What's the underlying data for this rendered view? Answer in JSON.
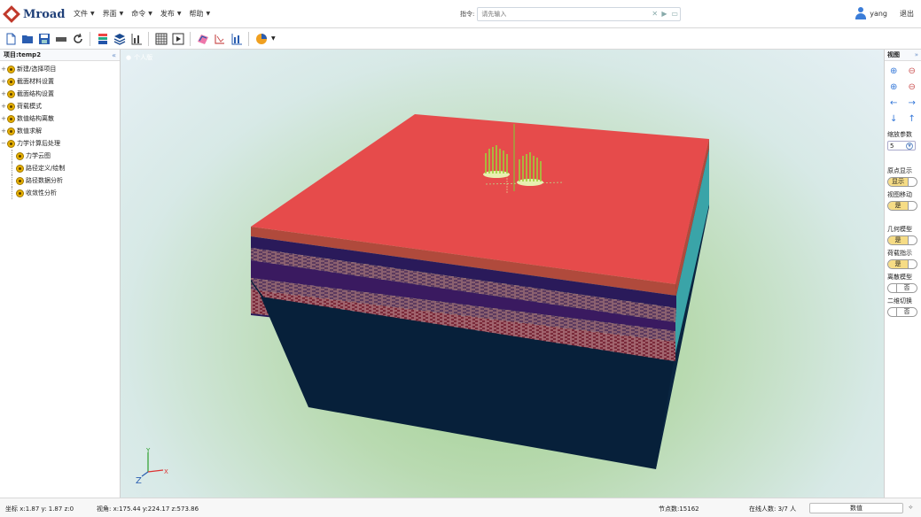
{
  "app": {
    "logo_text": "Mroad"
  },
  "menus": [
    {
      "label": "文件"
    },
    {
      "label": "界面"
    },
    {
      "label": "命令"
    },
    {
      "label": "发布"
    },
    {
      "label": "帮助"
    }
  ],
  "command": {
    "label": "指令:",
    "placeholder": "请先输入"
  },
  "user": {
    "name": "yang",
    "exit_label": "退出"
  },
  "left_panel": {
    "title": "项目:temp2",
    "collapse_glyph": "«",
    "items": [
      {
        "label": "新建/选择项目"
      },
      {
        "label": "截面材料设置"
      },
      {
        "label": "截面结构设置"
      },
      {
        "label": "荷载模式"
      },
      {
        "label": "数值结构离散"
      },
      {
        "label": "数值求解"
      },
      {
        "label": "力学计算后处理"
      }
    ],
    "children": [
      {
        "label": "力学云图"
      },
      {
        "label": "路径定义/绘制"
      },
      {
        "label": "路径数据分析"
      },
      {
        "label": "收敛性分析"
      }
    ]
  },
  "viewport": {
    "user_tag": "个人版"
  },
  "right_panel": {
    "title": "视图",
    "collapse_glyph": "»",
    "zoom_param_label": "缩放参数",
    "zoom_param_value": "5",
    "toggles": [
      {
        "label": "原点显示",
        "value": "显示",
        "state": "on"
      },
      {
        "label": "视图移动",
        "value": "是",
        "state": "on"
      }
    ],
    "toggles2": [
      {
        "label": "几何模型",
        "value": "是",
        "state": "on"
      },
      {
        "label": "荷载指示",
        "value": "是",
        "state": "on"
      },
      {
        "label": "离散模型",
        "value": "否",
        "state": "off"
      },
      {
        "label": "二维切换",
        "value": "否",
        "state": "off"
      }
    ]
  },
  "status": {
    "coord": "坐标 x:1.87  y: 1.87  z:0",
    "view_angle": "视角: x:175.44  y:224.17  z:573.86",
    "node_count": "节点数:15162",
    "online": "在线人数: 3/7 人",
    "box_value": "数值",
    "end_glyph": "⟡"
  },
  "axes": {
    "x": "X",
    "y": "Y",
    "z": "Z"
  },
  "colors": {
    "top_face": "#e64b4b",
    "front_base": "#07203a",
    "accent": "#3578d8"
  }
}
